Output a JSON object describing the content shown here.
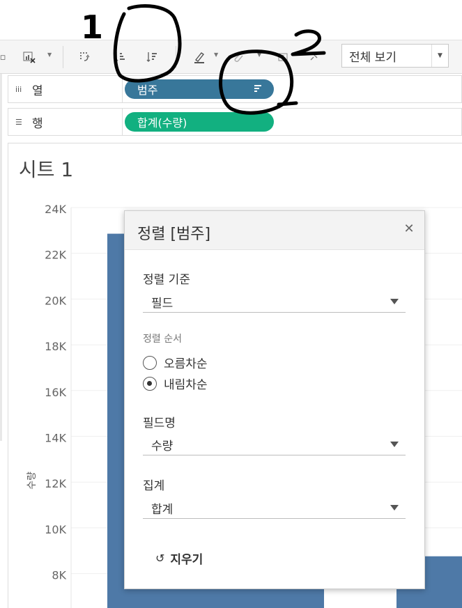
{
  "toolbar": {
    "icons": [
      "sheet-icon",
      "clear-sheet-icon",
      "swap-icon",
      "sort-ascending-icon",
      "sort-descending-icon",
      "highlight-icon",
      "group-icon",
      "label-icon",
      "pin-icon"
    ],
    "view_select": "전체 보기"
  },
  "shelves": {
    "columns": {
      "label": "열",
      "pill": "범주"
    },
    "rows": {
      "label": "행",
      "pill": "합계(수량)"
    }
  },
  "sheet": {
    "title": "시트 1"
  },
  "chart_data": {
    "type": "bar",
    "ylabel": "수량",
    "yticks": [
      "24K",
      "22K",
      "20K",
      "18K",
      "16K",
      "14K",
      "12K",
      "10K",
      "8K"
    ],
    "ylim": [
      6000,
      24000
    ],
    "series": [
      {
        "values": [
          23100,
          null,
          9000
        ]
      }
    ],
    "color": "#4e79a7"
  },
  "dialog": {
    "title": "정렬 [범주]",
    "sort_by_label": "정렬 기준",
    "sort_by_value": "필드",
    "order_label": "정렬 순서",
    "ascending": "오름차순",
    "descending": "내림차순",
    "selected_order": "내림차순",
    "field_name_label": "필드명",
    "field_name_value": "수량",
    "aggregation_label": "집계",
    "aggregation_value": "합계",
    "clear": "지우기"
  },
  "annotations": {
    "label_1": "1",
    "label_2": "2"
  }
}
